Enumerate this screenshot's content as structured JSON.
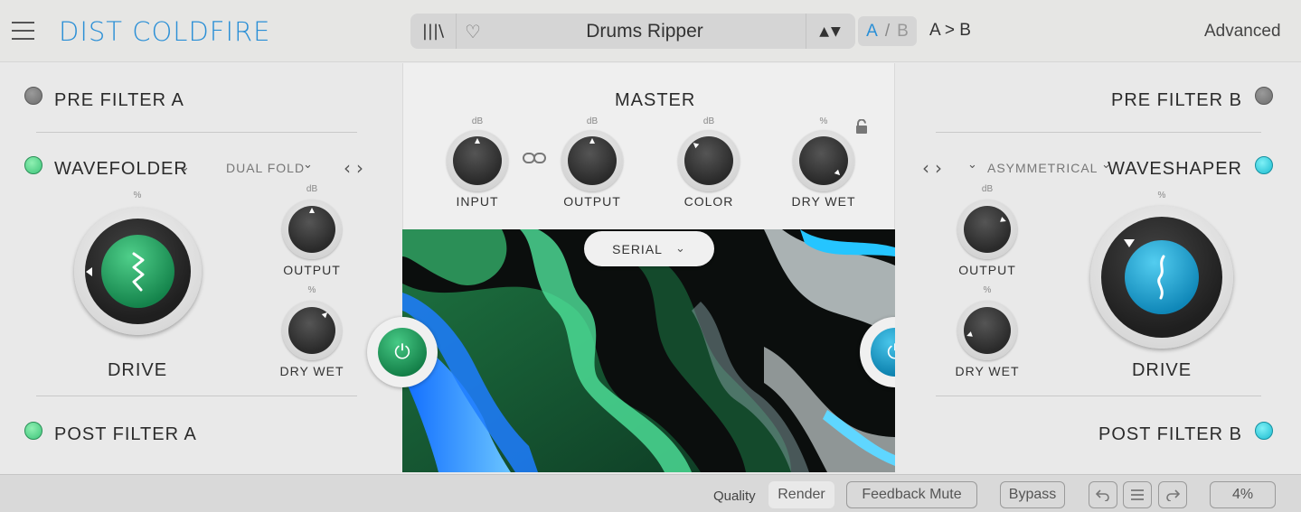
{
  "header": {
    "title": "DIST COLDFIRE",
    "library_icon": "|||\\",
    "heart_icon": "♡",
    "preset_name": "Drums Ripper",
    "preset_nav": "▲▼",
    "ab_a": "A",
    "ab_sep": "/",
    "ab_b": "B",
    "ab_copy": "A > B",
    "advanced": "Advanced"
  },
  "left": {
    "pre_filter": "PRE FILTER A",
    "module": "WAVEFOLDER",
    "mode": "DUAL FOLD",
    "drive_unit": "%",
    "drive": "DRIVE",
    "output_unit": "dB",
    "output": "OUTPUT",
    "drywet_unit": "%",
    "drywet": "DRY WET",
    "post_filter": "POST FILTER A"
  },
  "master": {
    "title": "MASTER",
    "input_unit": "dB",
    "input": "INPUT",
    "output_unit": "dB",
    "output": "OUTPUT",
    "color_unit": "dB",
    "color": "COLOR",
    "drywet_unit": "%",
    "drywet": "DRY  WET",
    "routing": "SERIAL"
  },
  "right": {
    "pre_filter": "PRE FILTER B",
    "mode": "ASYMMETRICAL",
    "module": "WAVESHAPER",
    "drive_unit": "%",
    "drive": "DRIVE",
    "output_unit": "dB",
    "output": "OUTPUT",
    "drywet_unit": "%",
    "drywet": "DRY WET",
    "post_filter": "POST FILTER B"
  },
  "status": {
    "quality_label": "Quality",
    "quality_value": "Render",
    "feedback_mute": "Feedback Mute",
    "bypass": "Bypass",
    "cpu": "4%"
  },
  "colors": {
    "accent_blue": "#2a8fd6",
    "green": "#1f9e5c",
    "cyan": "#17a9d4"
  }
}
